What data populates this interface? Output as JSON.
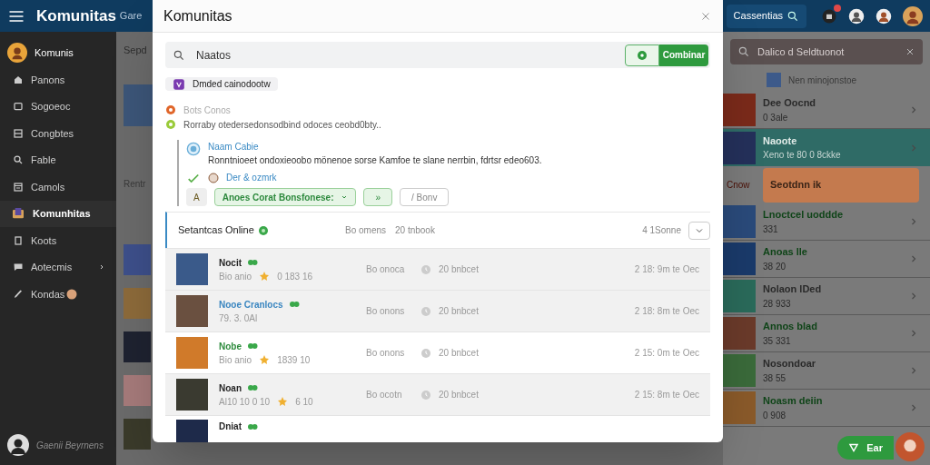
{
  "app_bar": {
    "title": "Komunitas",
    "subtitle": "Gare",
    "search_label": "Cassentias"
  },
  "sidebar": {
    "profile": {
      "name": "Komunis"
    },
    "items": [
      {
        "label": "Panons",
        "selected": false
      },
      {
        "label": "Sogoeoc",
        "selected": false
      },
      {
        "label": "Congbtes",
        "selected": false
      },
      {
        "label": "Fable",
        "selected": false
      },
      {
        "label": "Camols",
        "selected": false
      },
      {
        "label": "Komunhitas",
        "selected": true
      },
      {
        "label": "Koots",
        "selected": false
      },
      {
        "label": "Aotecmis",
        "selected": false,
        "expandable": true
      },
      {
        "label": "Kondas",
        "selected": false,
        "badge": true
      }
    ],
    "user": {
      "name": "Gaenii Beyrnens"
    }
  },
  "background": {
    "left_labels": [
      "Sepd",
      "Rentr"
    ],
    "search_placeholder": "Dalico d Seldtuonot",
    "list_header": "Nen minojonstoe",
    "items": [
      {
        "kind": "plain",
        "name": "Dee Oocnd",
        "meta": "0 3ale",
        "color": "#2a2a2a"
      },
      {
        "kind": "selected",
        "name": "Naoote",
        "meta": "Xeno te 80 0 8ckke",
        "color": "#e2ece9"
      },
      {
        "kind": "alert",
        "name": "Seotdnn ik",
        "side_label": "Cnow",
        "color": "#3a2417"
      },
      {
        "kind": "plain",
        "name": "Lnoctcel uoddde",
        "meta": "331",
        "color": "#0f4418"
      },
      {
        "kind": "plain",
        "name": "Anoas lle",
        "meta": "38 20",
        "color": "#0f4418"
      },
      {
        "kind": "plain",
        "name": "Nolaon lDed",
        "meta": "28 933",
        "color": "#2a2a2a"
      },
      {
        "kind": "plain",
        "name": "Annos blad",
        "meta": "35 331",
        "color": "#0f4418"
      },
      {
        "kind": "plain",
        "name": "Nosondoar",
        "meta": "38 55",
        "color": "#2a2a2a"
      },
      {
        "kind": "plain",
        "name": "Noasm deiin",
        "meta": "0 908",
        "color": "#0f4418"
      }
    ],
    "chat_chip": "Ear"
  },
  "dialog": {
    "title": "Komunitas",
    "search_value": "Naatos",
    "filter_on": true,
    "action_button": "Combinar",
    "chip": "Dmded cainodootw",
    "notes": [
      {
        "kind": "warning",
        "text": "Bots Conos"
      },
      {
        "kind": "info",
        "text": "Rorraby otedersedonsodbind odoces ceobd0bty.."
      }
    ],
    "post": {
      "author": "Naam Cabie",
      "body": "Ronntnioeet ondoxieoobo mönenoe sorse Kamfoe te slane nerrbin, fdrtsr edeo603.",
      "reply_link": "Der & ozmrk",
      "actions": [
        {
          "kind": "icon",
          "label": "A"
        },
        {
          "kind": "primary",
          "label": "Anoes Corat Bonsfonese:"
        },
        {
          "kind": "secondary",
          "label": "»"
        },
        {
          "kind": "outline",
          "label": "/ Bonv"
        }
      ]
    },
    "online": {
      "title": "Setantcas Online",
      "column_2": "Bo omens",
      "column_3": "20 tnbook",
      "count": "4 1Sonne",
      "rows": [
        {
          "name": "Nocit",
          "color": "#262626",
          "meta": "Bio anio",
          "score": "0 183 16",
          "status": "Bo onoca",
          "count": "20 bnbcet",
          "time": "2 18: 9m te Oec",
          "shaded": true
        },
        {
          "name": "Nooe Cranlocs",
          "color": "#3a86c0",
          "meta": "79. 3. 0Al",
          "status": "Bo onons",
          "count": "20 bnbcet",
          "time": "2 18: 8m te Oec",
          "shaded": true
        },
        {
          "name": "Nobe",
          "color": "#2e8b3d",
          "meta": "Bio anio",
          "score": "1839 10",
          "status": "Bo onons",
          "count": "20 bnbcet",
          "time": "2 15: 0m te Oec",
          "shaded": false
        },
        {
          "name": "Noan",
          "color": "#262626",
          "meta": "Al10 10 0 10",
          "score": "6 10",
          "status": "Bo ocotn",
          "count": "20 bnbcet",
          "time": "2 15: 8m te Oec",
          "shaded": true
        },
        {
          "name": "Dniat",
          "color": "#262626",
          "shaded": false
        }
      ]
    }
  }
}
